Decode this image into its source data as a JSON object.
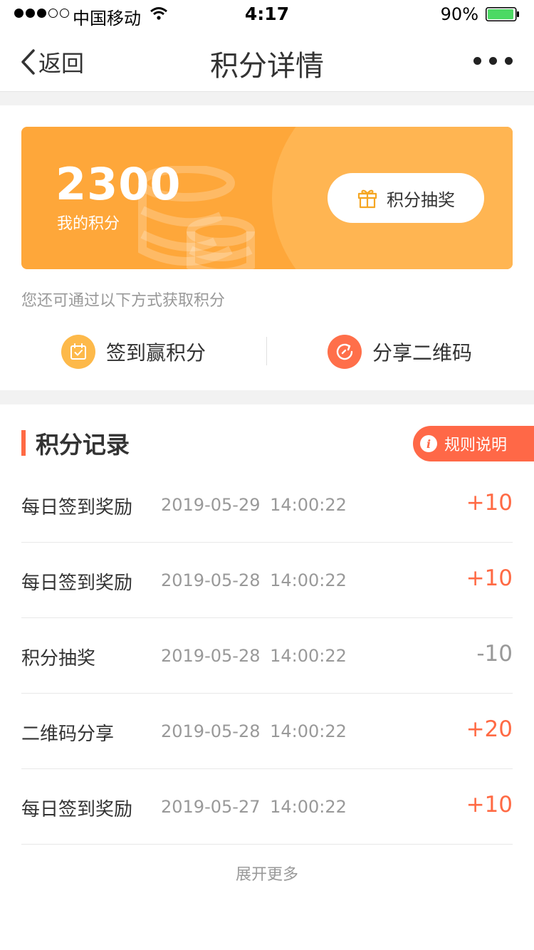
{
  "status_bar": {
    "carrier": "中国移动",
    "time": "4:17",
    "battery_percent": "90%"
  },
  "nav": {
    "back_label": "返回",
    "title": "积分详情"
  },
  "points_card": {
    "points": "2300",
    "points_label": "我的积分",
    "lottery_button": "积分抽奖"
  },
  "hint": "您还可通过以下方式获取积分",
  "earn_ways": [
    {
      "label": "签到赢积分",
      "icon": "calendar-check-icon"
    },
    {
      "label": "分享二维码",
      "icon": "share-refresh-icon"
    }
  ],
  "records": {
    "title": "积分记录",
    "rules_button": "规则说明",
    "items": [
      {
        "name": "每日签到奖励",
        "time": "2019-05-29 14:00:22",
        "points": "+10"
      },
      {
        "name": "每日签到奖励",
        "time": "2019-05-28 14:00:22",
        "points": "+10"
      },
      {
        "name": "积分抽奖",
        "time": "2019-05-28 14:00:22",
        "points": "-10"
      },
      {
        "name": "二维码分享",
        "time": "2019-05-28 14:00:22",
        "points": "+20"
      },
      {
        "name": "每日签到奖励",
        "time": "2019-05-27 14:00:22",
        "points": "+10"
      }
    ],
    "expand_more": "展开更多"
  },
  "colors": {
    "accent": "#ff6a44",
    "card": "#fea73a",
    "negative": "#999999"
  }
}
